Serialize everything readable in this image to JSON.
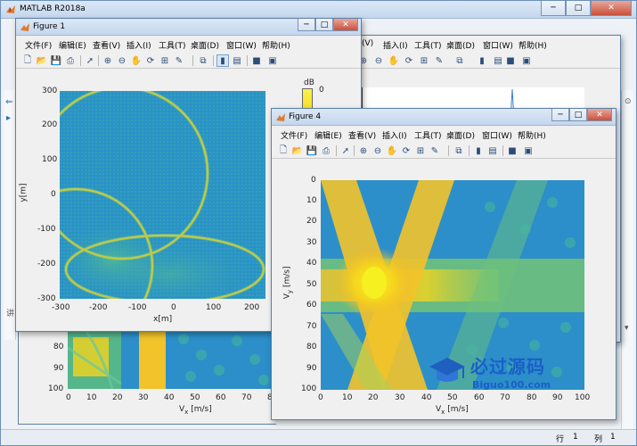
{
  "main_window": {
    "title": "MATLAB R2018a",
    "status": {
      "row_label": "行",
      "row_value": "1",
      "col_label": "列",
      "col_value": "1"
    }
  },
  "window_controls": {
    "minimize": "─",
    "maximize": "□",
    "close": "✕"
  },
  "figure1": {
    "title": "Figure 1",
    "menu": [
      "文件(F)",
      "编辑(E)",
      "查看(V)",
      "插入(I)",
      "工具(T)",
      "桌面(D)",
      "窗口(W)",
      "帮助(H)"
    ],
    "xlabel": "x[m]",
    "ylabel": "y[m]",
    "xticks": [
      "-300",
      "-200",
      "-100",
      "0",
      "100",
      "200"
    ],
    "yticks": [
      "300",
      "200",
      "100",
      "0",
      "-100",
      "-200",
      "-300"
    ],
    "colorbar_unit": "dB",
    "colorbar_top": "0"
  },
  "figure4": {
    "title": "Figure 4",
    "menu": [
      "文件(F)",
      "编辑(E)",
      "查看(V)",
      "插入(I)",
      "工具(T)",
      "桌面(D)",
      "窗口(W)",
      "帮助(H)"
    ],
    "xlabel": "V",
    "xlabel_sub": "x",
    "xlabel_unit": " [m/s]",
    "ylabel": "V",
    "ylabel_sub": "y",
    "ylabel_unit": " [m/s]",
    "xticks": [
      "0",
      "10",
      "20",
      "30",
      "40",
      "50",
      "60",
      "70",
      "80",
      "90",
      "100"
    ],
    "yticks": [
      "0",
      "10",
      "20",
      "30",
      "40",
      "50",
      "60",
      "70",
      "80",
      "90",
      "100"
    ]
  },
  "figure_behind": {
    "menu": [
      "(V)",
      "插入(I)",
      "工具(T)",
      "桌面(D)",
      "窗口(W)",
      "帮助(H)"
    ],
    "xlabel": "V",
    "xlabel_sub": "x",
    "xlabel_unit": " [m/s]",
    "xticks": [
      "0",
      "10",
      "20",
      "30",
      "40",
      "50",
      "60",
      "70",
      "80"
    ],
    "yticks": [
      "80",
      "90",
      "100"
    ]
  },
  "watermark": {
    "brand": "必过源码",
    "domain": "Biguo100.com"
  },
  "colors": {
    "plot_blue": "#2c8fc9",
    "plot_yellow": "#f5d51d",
    "plot_green": "#45b98a",
    "titlebar": "#c9d9ee"
  }
}
